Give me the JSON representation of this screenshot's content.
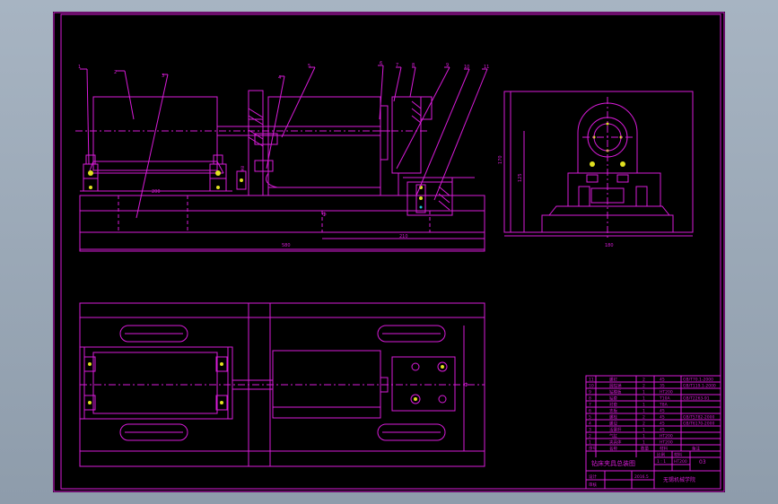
{
  "title_block": {
    "drawing_title": "钻床夹具总装图",
    "school": "无锡机械学院",
    "scale_label": "比例",
    "scale_value": "1 : 1",
    "material_label": "材料",
    "material_value": "HT200",
    "sheet_no": "03",
    "designer_label": "设计",
    "checker_label": "审核",
    "date_value": "2016.5"
  },
  "parts_list": [
    {
      "no": "11",
      "name": "螺钉",
      "qty": "2",
      "material": "45",
      "note": "GB/T70.1-2000"
    },
    {
      "no": "10",
      "name": "圆柱销",
      "qty": "2",
      "material": "35",
      "note": "GB/T119.1-2000"
    },
    {
      "no": "9",
      "name": "钻模板",
      "qty": "1",
      "material": "HT200",
      "note": ""
    },
    {
      "no": "8",
      "name": "钻套",
      "qty": "1",
      "material": "T10A",
      "note": "GB/T2263-91"
    },
    {
      "no": "7",
      "name": "衬套",
      "qty": "1",
      "material": "T8A",
      "note": ""
    },
    {
      "no": "6",
      "name": "支板",
      "qty": "1",
      "material": "45",
      "note": ""
    },
    {
      "no": "5",
      "name": "螺栓",
      "qty": "2",
      "material": "45",
      "note": "GB/T5782-2000"
    },
    {
      "no": "4",
      "name": "螺母",
      "qty": "2",
      "material": "45",
      "note": "GB/T6170-2000"
    },
    {
      "no": "3",
      "name": "活塞杆",
      "qty": "1",
      "material": "45",
      "note": ""
    },
    {
      "no": "2",
      "name": "气缸",
      "qty": "1",
      "material": "HT200",
      "note": ""
    },
    {
      "no": "1",
      "name": "夹具体",
      "qty": "1",
      "material": "HT200",
      "note": ""
    }
  ],
  "parts_header": {
    "no": "序号",
    "name": "名称",
    "qty": "数量",
    "material": "材料",
    "note": "备注"
  },
  "dimensions": {
    "front_length": "580",
    "front_sub": "210",
    "top_len": "200",
    "side_height": "170",
    "side_sub": "125",
    "side_width": "180"
  },
  "balloons": [
    "1",
    "2",
    "3",
    "4",
    "5",
    "6",
    "7",
    "8",
    "9",
    "10",
    "11"
  ]
}
